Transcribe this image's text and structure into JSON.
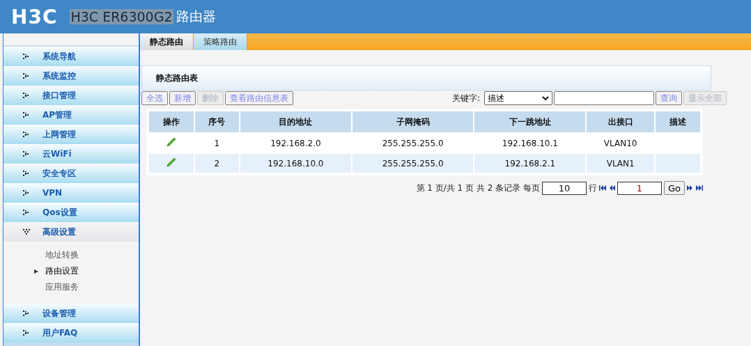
{
  "header": {
    "logo": "H3C",
    "model": "H3C ER6300G2",
    "title": "路由器"
  },
  "sidebar": {
    "items": [
      {
        "label": "系统导航",
        "expanded": false
      },
      {
        "label": "系统监控",
        "expanded": false
      },
      {
        "label": "接口管理",
        "expanded": false
      },
      {
        "label": "AP管理",
        "expanded": false
      },
      {
        "label": "上网管理",
        "expanded": false
      },
      {
        "label": "云WiFi",
        "expanded": false
      },
      {
        "label": "安全专区",
        "expanded": false
      },
      {
        "label": "VPN",
        "expanded": false
      },
      {
        "label": "Qos设置",
        "expanded": false
      },
      {
        "label": "高级设置",
        "expanded": true,
        "children": [
          {
            "label": "地址转换",
            "selected": false
          },
          {
            "label": "路由设置",
            "selected": true
          },
          {
            "label": "应用服务",
            "selected": false
          }
        ]
      },
      {
        "label": "设备管理",
        "expanded": false
      },
      {
        "label": "用户FAQ",
        "expanded": false
      }
    ]
  },
  "tabs": [
    {
      "label": "静态路由",
      "selected": true
    },
    {
      "label": "策略路由",
      "selected": false
    }
  ],
  "panel": {
    "title": "静态路由表"
  },
  "toolbar": {
    "buttons": [
      {
        "label": "全选",
        "disabled": false
      },
      {
        "label": "新增",
        "disabled": false
      },
      {
        "label": "删除",
        "disabled": true
      },
      {
        "label": "查看路由信息表",
        "disabled": false
      }
    ],
    "keyword_label": "关键字:",
    "keyword_select": "描述",
    "search_button": "查询",
    "show_all_button": "显示全部"
  },
  "table": {
    "columns": [
      "操作",
      "序号",
      "目的地址",
      "子网掩码",
      "下一跳地址",
      "出接口",
      "描述"
    ],
    "rows": [
      {
        "index": "1",
        "destination": "192.168.2.0",
        "mask": "255.255.255.0",
        "next_hop": "192.168.10.1",
        "interface": "VLAN10"
      },
      {
        "index": "2",
        "destination": "192.168.10.0",
        "mask": "255.255.255.0",
        "next_hop": "192.168.2.1",
        "interface": "VLAN1"
      }
    ]
  },
  "pagination": {
    "summary": "第 1 页/共 1 页 共 2 条记录 每页",
    "page_size": "10",
    "rows_label": "行",
    "page": "1",
    "go": "Go"
  }
}
